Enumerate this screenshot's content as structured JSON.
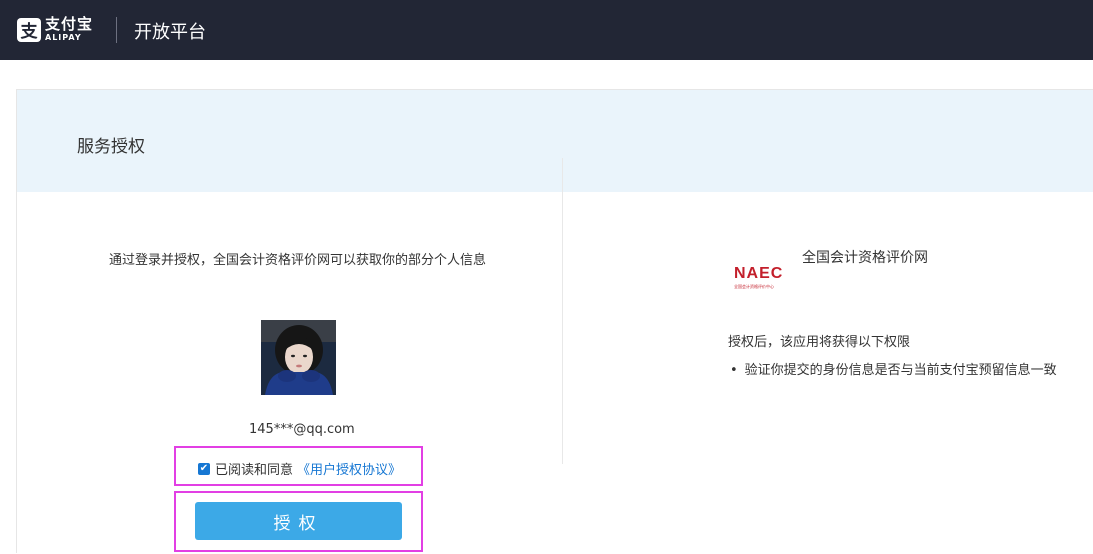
{
  "header": {
    "logo_icon": "alipay-icon",
    "logo_glyph": "支",
    "logo_zh": "支付宝",
    "logo_en": "ALIPAY",
    "platform": "开放平台"
  },
  "banner": {
    "title": "服务授权"
  },
  "left": {
    "intro": "通过登录并授权，全国会计资格评价网可以获取你的部分个人信息",
    "email": "145***@qq.com",
    "agree_text": "已阅读和同意",
    "agree_link": "《用户授权协议》",
    "checkbox_checked": true,
    "authorize_label": "授权"
  },
  "right": {
    "app_name": "全国会计资格评价网",
    "logo_text": "NAEC",
    "logo_subtext": "全国会计资格评价中心",
    "perm_title": "授权后，该应用将获得以下权限",
    "permissions": [
      "验证你提交的身份信息是否与当前支付宝预留信息一致"
    ]
  },
  "colors": {
    "topbar": "#222635",
    "banner": "#eaf4fb",
    "button": "#3ca9e7",
    "link": "#1677d3",
    "highlight": "#e23fe4"
  }
}
